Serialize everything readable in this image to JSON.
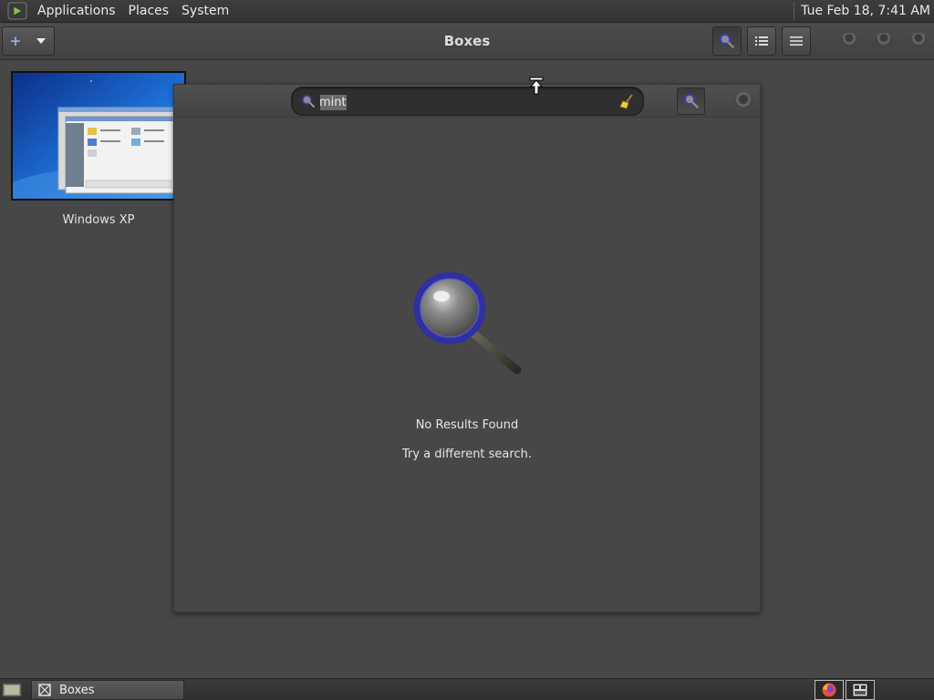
{
  "top_panel": {
    "menus": [
      "Applications",
      "Places",
      "System"
    ],
    "clock": "Tue Feb 18,  7:41 AM"
  },
  "header": {
    "title": "Boxes",
    "new_button_icon": "plus-icon",
    "search_button_icon": "search-icon",
    "list_view_icon": "list-view-icon",
    "menu_icon": "hamburger-menu-icon"
  },
  "boxes": [
    {
      "name": "Windows XP"
    }
  ],
  "search": {
    "query": "mint",
    "clear_icon": "broom-clear-icon"
  },
  "empty_state": {
    "title": "No Results Found",
    "subtitle": "Try a different search."
  },
  "taskbar": {
    "window_title": "Boxes",
    "tray_icons": [
      "firefox-icon",
      "keyboard-layout-icon"
    ]
  },
  "colors": {
    "accent": "#3d3da8",
    "background": "#474747",
    "panel": "#333333"
  }
}
